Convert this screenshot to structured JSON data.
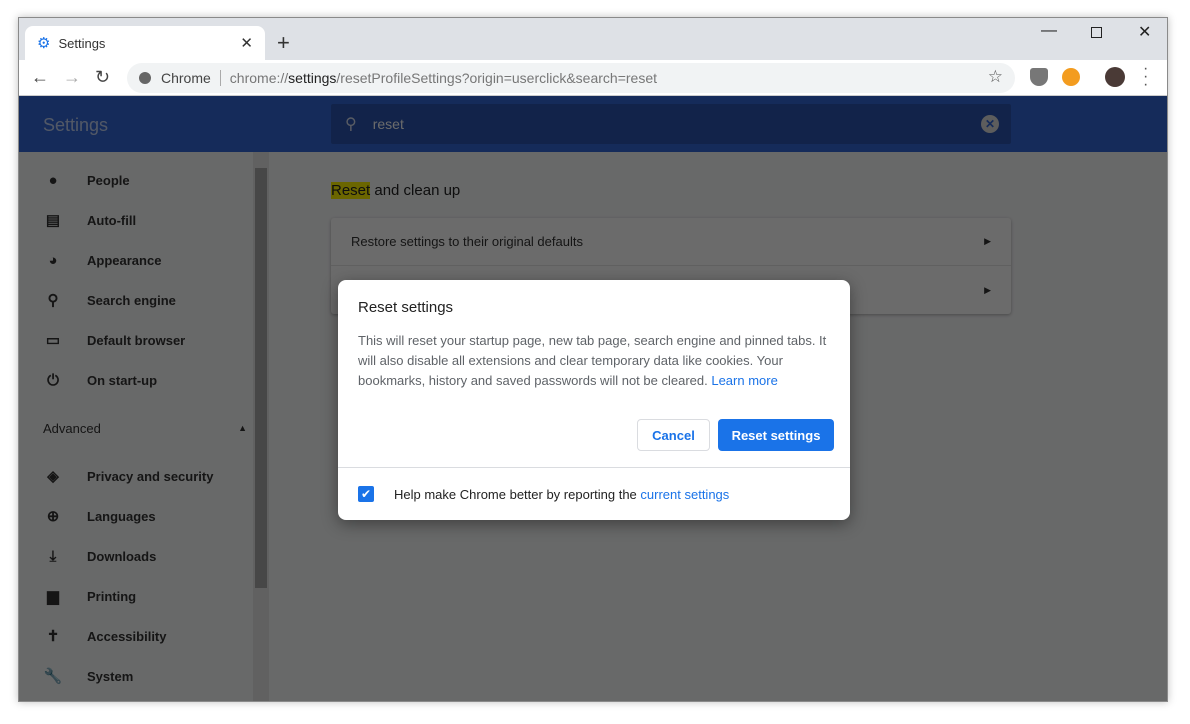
{
  "tab": {
    "title": "Settings",
    "icon": "gear-icon"
  },
  "toolbar": {
    "site": "Chrome",
    "url_prefix": "chrome://",
    "url_host": "settings",
    "url_path": "/resetProfileSettings?origin=userclick&search=reset"
  },
  "header": {
    "title": "Settings",
    "search_value": "reset"
  },
  "sidebar": {
    "items": [
      {
        "label": "People",
        "icon": "person-icon",
        "glyph": "●"
      },
      {
        "label": "Auto-fill",
        "icon": "clipboard-icon",
        "glyph": "▤"
      },
      {
        "label": "Appearance",
        "icon": "palette-icon",
        "glyph": "◕"
      },
      {
        "label": "Search engine",
        "icon": "search-icon",
        "glyph": "⚲"
      },
      {
        "label": "Default browser",
        "icon": "browser-icon",
        "glyph": "▭"
      },
      {
        "label": "On start-up",
        "icon": "power-icon",
        "glyph": "⏻"
      }
    ],
    "advanced": "Advanced",
    "advanced_items": [
      {
        "label": "Privacy and security",
        "icon": "shield-icon",
        "glyph": "◈"
      },
      {
        "label": "Languages",
        "icon": "globe-icon",
        "glyph": "⊕"
      },
      {
        "label": "Downloads",
        "icon": "download-icon",
        "glyph": "⤓"
      },
      {
        "label": "Printing",
        "icon": "printer-icon",
        "glyph": "▆"
      },
      {
        "label": "Accessibility",
        "icon": "accessibility-icon",
        "glyph": "✝"
      },
      {
        "label": "System",
        "icon": "wrench-icon",
        "glyph": "🔧"
      }
    ]
  },
  "main": {
    "section_highlight": "Reset",
    "section_rest": " and clean up",
    "rows": [
      "Restore settings to their original defaults",
      ""
    ]
  },
  "dialog": {
    "title": "Reset settings",
    "body": "This will reset your startup page, new tab page, search engine and pinned tabs. It will also disable all extensions and clear temporary data like cookies. Your bookmarks, history and saved passwords will not be cleared. ",
    "learn_more": "Learn more",
    "cancel": "Cancel",
    "reset": "Reset settings",
    "footer_text": "Help make Chrome better by reporting the ",
    "footer_link": "current settings",
    "checkbox_checked": true
  },
  "colors": {
    "accent": "#1a73e8",
    "header": "#3367d6",
    "highlight": "#fff200"
  }
}
